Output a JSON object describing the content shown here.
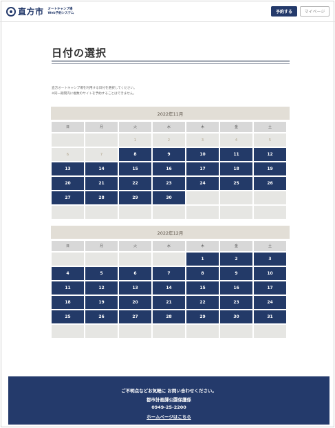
{
  "header": {
    "logo_text": "直方市",
    "logo_sub_line1": "オートキャンプ場",
    "logo_sub_line2": "Web予約システム",
    "reserve_button": "予約する",
    "mypage_button": "マイページ"
  },
  "page": {
    "title": "日付の選択",
    "description_line1": "直方オートキャンプ場を利用する日付を選択してください。",
    "description_line2": "※同一期間内に複数のサイトを予約することはできません。"
  },
  "weekdays": [
    "日",
    "月",
    "火",
    "水",
    "木",
    "金",
    "土"
  ],
  "calendars": [
    {
      "heading": "2022年11月",
      "cells": [
        {
          "t": "",
          "s": "blank"
        },
        {
          "t": "",
          "s": "blank"
        },
        {
          "t": "1",
          "s": "past"
        },
        {
          "t": "2",
          "s": "past"
        },
        {
          "t": "3",
          "s": "past"
        },
        {
          "t": "4",
          "s": "past"
        },
        {
          "t": "5",
          "s": "past"
        },
        {
          "t": "6",
          "s": "past"
        },
        {
          "t": "7",
          "s": "past"
        },
        {
          "t": "8",
          "s": "on"
        },
        {
          "t": "9",
          "s": "on"
        },
        {
          "t": "10",
          "s": "on"
        },
        {
          "t": "11",
          "s": "on"
        },
        {
          "t": "12",
          "s": "on"
        },
        {
          "t": "13",
          "s": "on"
        },
        {
          "t": "14",
          "s": "on"
        },
        {
          "t": "15",
          "s": "on"
        },
        {
          "t": "16",
          "s": "on"
        },
        {
          "t": "17",
          "s": "on"
        },
        {
          "t": "18",
          "s": "on"
        },
        {
          "t": "19",
          "s": "on"
        },
        {
          "t": "20",
          "s": "on"
        },
        {
          "t": "21",
          "s": "on"
        },
        {
          "t": "22",
          "s": "on"
        },
        {
          "t": "23",
          "s": "on"
        },
        {
          "t": "24",
          "s": "on"
        },
        {
          "t": "25",
          "s": "on"
        },
        {
          "t": "26",
          "s": "on"
        },
        {
          "t": "27",
          "s": "on"
        },
        {
          "t": "28",
          "s": "on"
        },
        {
          "t": "29",
          "s": "on"
        },
        {
          "t": "30",
          "s": "on"
        },
        {
          "t": "",
          "s": "blank"
        },
        {
          "t": "",
          "s": "blank"
        },
        {
          "t": "",
          "s": "blank"
        },
        {
          "t": "",
          "s": "blank"
        },
        {
          "t": "",
          "s": "blank"
        },
        {
          "t": "",
          "s": "blank"
        },
        {
          "t": "",
          "s": "blank"
        },
        {
          "t": "",
          "s": "blank"
        },
        {
          "t": "",
          "s": "blank"
        },
        {
          "t": "",
          "s": "blank"
        }
      ]
    },
    {
      "heading": "2022年12月",
      "cells": [
        {
          "t": "",
          "s": "blank"
        },
        {
          "t": "",
          "s": "blank"
        },
        {
          "t": "",
          "s": "blank"
        },
        {
          "t": "",
          "s": "blank"
        },
        {
          "t": "1",
          "s": "on"
        },
        {
          "t": "2",
          "s": "on"
        },
        {
          "t": "3",
          "s": "on"
        },
        {
          "t": "4",
          "s": "on"
        },
        {
          "t": "5",
          "s": "on"
        },
        {
          "t": "6",
          "s": "on"
        },
        {
          "t": "7",
          "s": "on"
        },
        {
          "t": "8",
          "s": "on"
        },
        {
          "t": "9",
          "s": "on"
        },
        {
          "t": "10",
          "s": "on"
        },
        {
          "t": "11",
          "s": "on"
        },
        {
          "t": "12",
          "s": "on"
        },
        {
          "t": "13",
          "s": "on"
        },
        {
          "t": "14",
          "s": "on"
        },
        {
          "t": "15",
          "s": "on"
        },
        {
          "t": "16",
          "s": "on"
        },
        {
          "t": "17",
          "s": "on"
        },
        {
          "t": "18",
          "s": "on"
        },
        {
          "t": "19",
          "s": "on"
        },
        {
          "t": "20",
          "s": "on"
        },
        {
          "t": "21",
          "s": "on"
        },
        {
          "t": "22",
          "s": "on"
        },
        {
          "t": "23",
          "s": "on"
        },
        {
          "t": "24",
          "s": "on"
        },
        {
          "t": "25",
          "s": "on"
        },
        {
          "t": "26",
          "s": "on"
        },
        {
          "t": "27",
          "s": "on"
        },
        {
          "t": "28",
          "s": "on"
        },
        {
          "t": "29",
          "s": "on"
        },
        {
          "t": "30",
          "s": "on"
        },
        {
          "t": "31",
          "s": "on"
        },
        {
          "t": "",
          "s": "blank"
        },
        {
          "t": "",
          "s": "blank"
        },
        {
          "t": "",
          "s": "blank"
        },
        {
          "t": "",
          "s": "blank"
        },
        {
          "t": "",
          "s": "blank"
        },
        {
          "t": "",
          "s": "blank"
        },
        {
          "t": "",
          "s": "blank"
        }
      ]
    }
  ],
  "footer": {
    "line1": "ご不明点などお気軽に お問い合わせください。",
    "line2": "都市計画課公園保護係",
    "line3": "0949-25-2200",
    "link": "ホームページはこちら"
  },
  "colors": {
    "primary": "#243a6b",
    "available_day": "#233a68",
    "month_header": "#e2ded6"
  }
}
